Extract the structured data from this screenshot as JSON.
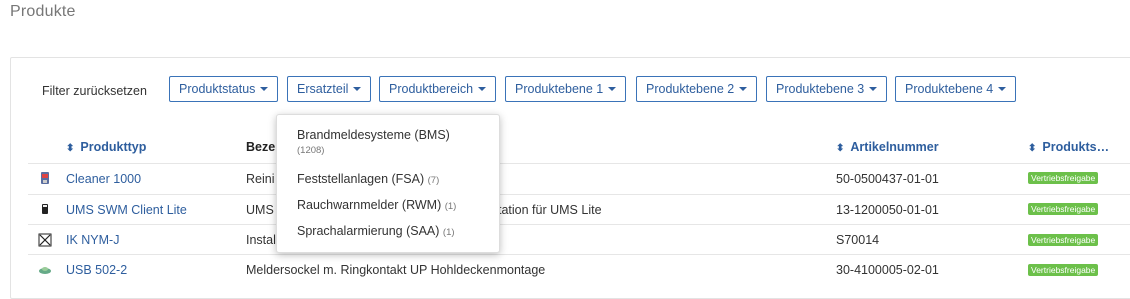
{
  "page": {
    "title": "Produkte"
  },
  "filters": {
    "reset_label": "Filter zurücksetzen",
    "buttons": [
      "Produktstatus",
      "Ersatzteil",
      "Produktbereich",
      "Produktebene 1",
      "Produktebene 2",
      "Produktebene 3",
      "Produktebene 4"
    ]
  },
  "table": {
    "headers": {
      "produkttyp": "Produkttyp",
      "bezeichnung": "Beze",
      "artikelnummer": "Artikelnummer",
      "produktstatus": "Produkts…"
    },
    "rows": [
      {
        "name": "Cleaner 1000",
        "desc": "Reini",
        "article": "50-0500437-01-01",
        "status": "Vertriebsfreigabe",
        "icon": "cleaner-icon"
      },
      {
        "name": "UMS SWM Client Lite",
        "desc": "UMS",
        "desc_tail": "tation für UMS Lite",
        "article": "13-1200050-01-01",
        "status": "Vertriebsfreigabe",
        "icon": "usb-stick-icon"
      },
      {
        "name": "IK NYM-J",
        "desc": "Instal",
        "article": "S70014",
        "status": "Vertriebsfreigabe",
        "icon": "cable-icon"
      },
      {
        "name": "USB 502-2",
        "desc": "Meldersockel m. Ringkontakt UP Hohldeckenmontage",
        "article": "30-4100005-02-01",
        "status": "Vertriebsfreigabe",
        "icon": "detector-base-icon"
      }
    ]
  },
  "dropdown": {
    "items": [
      {
        "label": "Brandmeldesysteme (BMS)",
        "count": "(1208)"
      },
      {
        "label": "Feststellanlagen (FSA)",
        "count": "(7)"
      },
      {
        "label": "Rauchwarnmelder (RWM)",
        "count": "(1)"
      },
      {
        "label": "Sprachalarmierung (SAA)",
        "count": "(1)"
      }
    ]
  },
  "colors": {
    "accent": "#2e5e9e",
    "badge": "#6cc04a"
  }
}
